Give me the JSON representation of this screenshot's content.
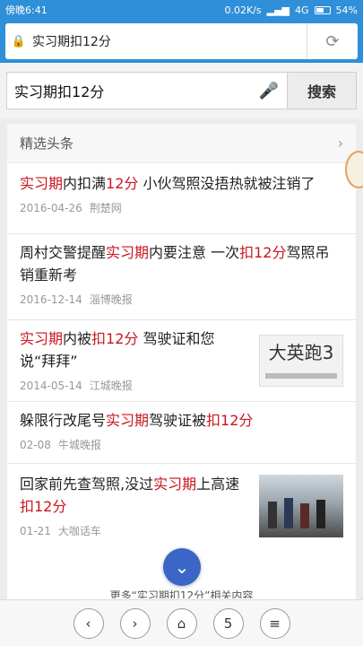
{
  "status": {
    "left": "傍晚6:41",
    "speed": "0.02K/s",
    "network": "4G",
    "battery": "54%"
  },
  "url": {
    "text": "实习期扣12分"
  },
  "search": {
    "query": "实习期扣12分",
    "button": "搜索"
  },
  "section": {
    "title": "精选头条"
  },
  "news": [
    {
      "parts": [
        [
          "实习期",
          "h"
        ],
        [
          "内扣满",
          ""
        ],
        [
          "12分",
          "h"
        ],
        [
          " 小伙驾照没捂热就被注销了",
          ""
        ]
      ],
      "date": "2016-04-26",
      "source": "荆楚网"
    },
    {
      "parts": [
        [
          "周村交警提醒",
          ""
        ],
        [
          "实习期",
          "h"
        ],
        [
          "内要注意 一次",
          ""
        ],
        [
          "扣12分",
          "h"
        ],
        [
          "驾照吊销重新考",
          ""
        ]
      ],
      "date": "2016-12-14",
      "source": "淄博晚报"
    },
    {
      "parts": [
        [
          "实习期",
          "h"
        ],
        [
          "内被",
          ""
        ],
        [
          "扣12分",
          "h"
        ],
        [
          " 驾驶证和您说“拜拜”",
          ""
        ]
      ],
      "date": "2014-05-14",
      "source": "江城晚报",
      "thumb_text": "大英跑3"
    },
    {
      "parts": [
        [
          "躲限行改尾号",
          ""
        ],
        [
          "实习期",
          "h"
        ],
        [
          "驾驶证被",
          ""
        ],
        [
          "扣12分",
          "h"
        ]
      ],
      "date": "02-08",
      "source": "牛城晚报"
    },
    {
      "parts": [
        [
          "回家前先查驾照,没过",
          ""
        ],
        [
          "实习期",
          "h"
        ],
        [
          "上高速",
          ""
        ],
        [
          "扣12分",
          "h"
        ]
      ],
      "date": "01-21",
      "source": "大咖话车"
    }
  ],
  "more_text": "更多“实习期扣12分”相关内容",
  "toolbar": {
    "tabs": "5"
  },
  "colors": {
    "accent": "#2f8fd8",
    "highlight": "#c8161e",
    "fab": "#3b66c7"
  }
}
